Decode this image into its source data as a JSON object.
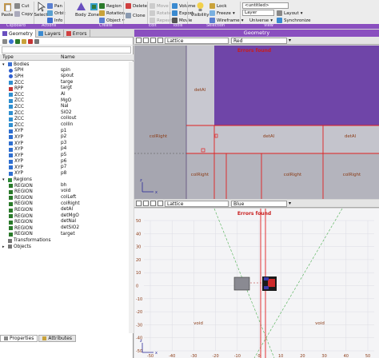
{
  "ribbon": {
    "paste": "Paste",
    "cut": "Cut",
    "copy": "Copy",
    "pan": "Pan",
    "orbit": "Orbit",
    "info": "Info",
    "select": "Select",
    "body": "Body",
    "zone": "Zone",
    "region": "Region",
    "rotation": "Rotation",
    "object": "Object",
    "delete": "Delete",
    "clone": "Clone",
    "move": "Move",
    "rotate": "Rotate",
    "repeat": "Repeat",
    "volume": "Volume",
    "export": "Export",
    "movie": "Movie",
    "lock": "Lock",
    "freeze": "Freeze",
    "wireframe": "Wireframe",
    "visibility": "Visibility",
    "combo_untitled": "<untitled>",
    "combo_layer": "Layer",
    "layout": "Layout",
    "synchronize": "Synchronize",
    "universe": "Universe",
    "captions": [
      "Clipboard",
      "Actions",
      "Create",
      "Edit",
      "Tools",
      "Selection",
      "View"
    ]
  },
  "left": {
    "tabs": [
      "Geometry",
      "Layers",
      "Errors"
    ],
    "header_type": "Type",
    "header_name": "Name",
    "rows": [
      {
        "indent": 0,
        "type": "Bodies",
        "name": "",
        "icon": "folder",
        "color": "#3b6fd1",
        "arrow": "▾"
      },
      {
        "indent": 1,
        "type": "SPH",
        "name": "spin",
        "icon": "sphere",
        "color": "#2f5fcf"
      },
      {
        "indent": 1,
        "type": "SPH",
        "name": "spout",
        "icon": "sphere",
        "color": "#2f5fcf"
      },
      {
        "indent": 1,
        "type": "ZCC",
        "name": "targe",
        "icon": "cyl",
        "color": "#2f8fd0"
      },
      {
        "indent": 1,
        "type": "RPP",
        "name": "targt",
        "icon": "box",
        "color": "#c43434"
      },
      {
        "indent": 1,
        "type": "ZCC",
        "name": "Al",
        "icon": "cyl",
        "color": "#2f8fd0"
      },
      {
        "indent": 1,
        "type": "ZCC",
        "name": "MgO",
        "icon": "cyl",
        "color": "#2f8fd0"
      },
      {
        "indent": 1,
        "type": "ZCC",
        "name": "NaI",
        "icon": "cyl",
        "color": "#2f8fd0"
      },
      {
        "indent": 1,
        "type": "ZCC",
        "name": "SiO2",
        "icon": "cyl",
        "color": "#2f8fd0"
      },
      {
        "indent": 1,
        "type": "ZCC",
        "name": "collout",
        "icon": "cyl",
        "color": "#2f8fd0"
      },
      {
        "indent": 1,
        "type": "ZCC",
        "name": "collin",
        "icon": "cyl",
        "color": "#2f8fd0"
      },
      {
        "indent": 1,
        "type": "XYP",
        "name": "p1",
        "icon": "plane",
        "color": "#2f6fd0"
      },
      {
        "indent": 1,
        "type": "XYP",
        "name": "p2",
        "icon": "plane",
        "color": "#2f6fd0"
      },
      {
        "indent": 1,
        "type": "XYP",
        "name": "p3",
        "icon": "plane",
        "color": "#2f6fd0"
      },
      {
        "indent": 1,
        "type": "XYP",
        "name": "p4",
        "icon": "plane",
        "color": "#2f6fd0"
      },
      {
        "indent": 1,
        "type": "XYP",
        "name": "p5",
        "icon": "plane",
        "color": "#2f6fd0"
      },
      {
        "indent": 1,
        "type": "XYP",
        "name": "p6",
        "icon": "plane",
        "color": "#2f6fd0"
      },
      {
        "indent": 1,
        "type": "XYP",
        "name": "p7",
        "icon": "plane",
        "color": "#2f6fd0"
      },
      {
        "indent": 1,
        "type": "XYP",
        "name": "p8",
        "icon": "plane",
        "color": "#2f6fd0"
      },
      {
        "indent": 0,
        "type": "Regions",
        "name": "",
        "icon": "folder",
        "color": "#2f8a3a",
        "arrow": "▾"
      },
      {
        "indent": 1,
        "type": "REGION",
        "name": "bh",
        "icon": "region",
        "color": "#2a7a2a"
      },
      {
        "indent": 1,
        "type": "REGION",
        "name": "void",
        "icon": "region",
        "color": "#2a7a2a"
      },
      {
        "indent": 1,
        "type": "REGION",
        "name": "colLeft",
        "icon": "region",
        "color": "#2a7a2a"
      },
      {
        "indent": 1,
        "type": "REGION",
        "name": "colRight",
        "icon": "region",
        "color": "#2a7a2a"
      },
      {
        "indent": 1,
        "type": "REGION",
        "name": "detAl",
        "icon": "region",
        "color": "#2a7a2a"
      },
      {
        "indent": 1,
        "type": "REGION",
        "name": "detMgO",
        "icon": "region",
        "color": "#2a7a2a"
      },
      {
        "indent": 1,
        "type": "REGION",
        "name": "detNaI",
        "icon": "region",
        "color": "#2a7a2a"
      },
      {
        "indent": 1,
        "type": "REGION",
        "name": "detSiO2",
        "icon": "region",
        "color": "#2a7a2a"
      },
      {
        "indent": 1,
        "type": "REGION",
        "name": "target",
        "icon": "region",
        "color": "#2a7a2a"
      },
      {
        "indent": 0,
        "type": "Transformations",
        "name": "",
        "icon": "folder",
        "color": "#777777",
        "arrow": ""
      },
      {
        "indent": 0,
        "type": "Objects",
        "name": "",
        "icon": "folder",
        "color": "#777777",
        "arrow": "▸"
      }
    ],
    "bottom_tabs": [
      "Properties",
      "Attributes"
    ]
  },
  "geometry_title": "Geometry",
  "viewport_top": {
    "dropdown_view": "Lattice",
    "dropdown_color": "Red",
    "error_text": "Errors found",
    "labels": [
      "detAl",
      "colRight",
      "detAl",
      "detAl",
      "colRight",
      "colRight",
      "colRight"
    ],
    "axis_labels": [
      "z",
      "x"
    ]
  },
  "viewport_bottom": {
    "dropdown_view": "Lattice",
    "dropdown_color": "Blue",
    "error_text": "Errors found",
    "y_ticks": [
      "50",
      "40",
      "30",
      "20",
      "10",
      "0",
      "-10",
      "-20",
      "-30",
      "-40",
      "-50"
    ],
    "x_ticks": [
      "-50",
      "-40",
      "-30",
      "-20",
      "-10",
      "0",
      "10",
      "20",
      "30",
      "40",
      "50"
    ],
    "void_labels": [
      "void",
      "void"
    ],
    "axis_labels": [
      "z",
      "x"
    ]
  },
  "colors": {
    "accent": "#8a4fbf",
    "region_purple": "#6f45a8",
    "region_grey": "#a9a9b4",
    "error_red": "#e02020"
  }
}
